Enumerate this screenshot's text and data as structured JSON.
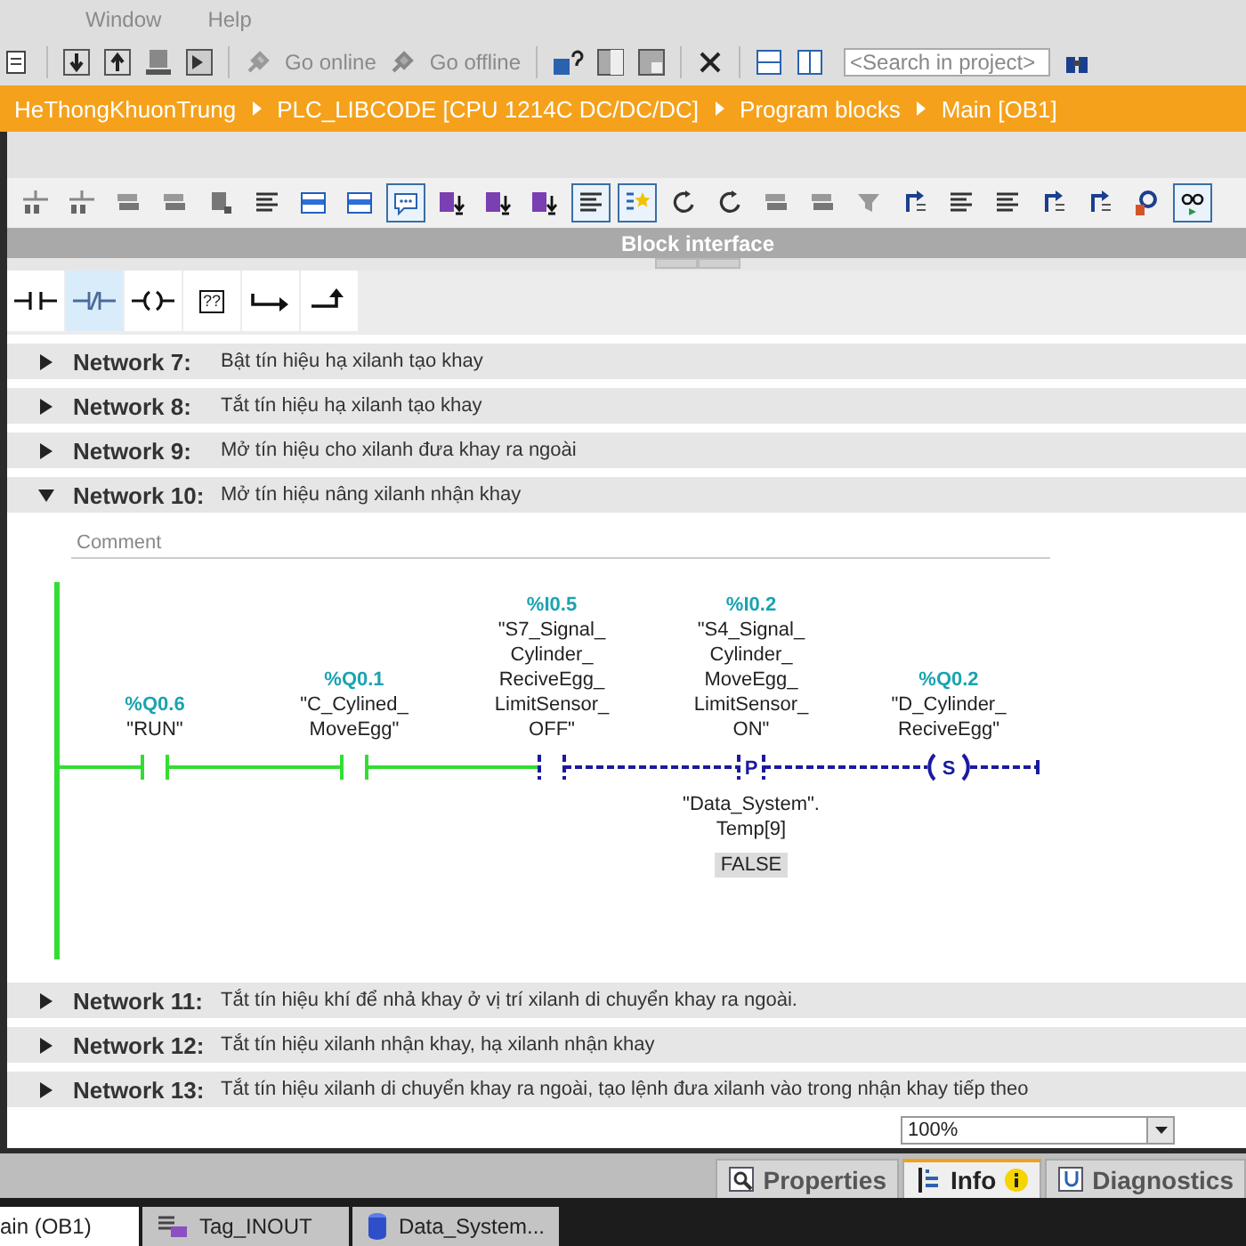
{
  "menu": [
    {
      "label": "Window"
    },
    {
      "label": "Help"
    }
  ],
  "toolbar": {
    "go_online": "Go online",
    "go_offline": "Go offline",
    "search": {
      "placeholder": "<Search in project>"
    }
  },
  "breadcrumb": [
    "HeThongKhuonTrung",
    "PLC_LIBCODE [CPU 1214C DC/DC/DC]",
    "Program blocks",
    "Main [OB1]"
  ],
  "editor_toolbar": [
    {
      "kind": "network",
      "selected": false
    },
    {
      "kind": "network",
      "selected": false
    },
    {
      "kind": "stack",
      "selected": false
    },
    {
      "kind": "stack",
      "selected": false
    },
    {
      "kind": "block",
      "selected": false
    },
    {
      "kind": "list",
      "selected": false
    },
    {
      "kind": "panel",
      "selected": false
    },
    {
      "kind": "panel",
      "selected": false
    },
    {
      "kind": "comment",
      "selected": true
    },
    {
      "kind": "download",
      "selected": false
    },
    {
      "kind": "download",
      "selected": false
    },
    {
      "kind": "download",
      "selected": false
    },
    {
      "kind": "list",
      "selected": true
    },
    {
      "kind": "star",
      "selected": true
    },
    {
      "kind": "refresh",
      "selected": false
    },
    {
      "kind": "refresh",
      "selected": false
    },
    {
      "kind": "stack",
      "selected": false
    },
    {
      "kind": "stack",
      "selected": false
    },
    {
      "kind": "funnel",
      "selected": false
    },
    {
      "kind": "jump",
      "selected": false
    },
    {
      "kind": "list",
      "selected": false
    },
    {
      "kind": "list",
      "selected": false
    },
    {
      "kind": "jump",
      "selected": false
    },
    {
      "kind": "jump",
      "selected": false
    },
    {
      "kind": "search",
      "selected": false
    },
    {
      "kind": "glasses",
      "selected": true
    }
  ],
  "block_interface": {
    "title": "Block interface"
  },
  "lad_elements": [
    {
      "kind": "no_contact",
      "selected": false
    },
    {
      "kind": "nc_contact",
      "selected": true
    },
    {
      "kind": "coil",
      "selected": false
    },
    {
      "kind": "box",
      "label": "??",
      "selected": false
    },
    {
      "kind": "branch_open",
      "selected": false
    },
    {
      "kind": "branch_close",
      "selected": false
    }
  ],
  "networks": [
    {
      "title": "Network 7:",
      "comment": "Bật tín hiệu hạ xilanh tạo khay",
      "expanded": false
    },
    {
      "title": "Network 8:",
      "comment": "Tắt tín hiệu hạ xilanh tạo khay",
      "expanded": false
    },
    {
      "title": "Network 9:",
      "comment": "Mở tín hiệu cho xilanh đưa khay ra ngoài",
      "expanded": false
    },
    {
      "title": "Network 10:",
      "comment": "Mở tín hiệu nâng xilanh nhận khay",
      "expanded": true,
      "comment_field": {
        "placeholder": "Comment"
      },
      "rung": [
        {
          "kind": "contact",
          "address": "%Q0.6",
          "tag": [
            "\"RUN\""
          ],
          "energized": true
        },
        {
          "kind": "contact",
          "address": "%Q0.1",
          "tag": [
            "\"C_Cylined_",
            "MoveEgg\""
          ],
          "energized": true
        },
        {
          "kind": "contact",
          "address": "%I0.5",
          "tag": [
            "\"S7_Signal_",
            "Cylinder_",
            "ReciveEgg_",
            "LimitSensor_",
            "OFF\""
          ],
          "energized": false
        },
        {
          "kind": "p_contact",
          "symbol": "P",
          "address": "%I0.2",
          "tag": [
            "\"S4_Signal_",
            "Cylinder_",
            "MoveEgg_",
            "LimitSensor_",
            "ON\""
          ],
          "operand": [
            "\"Data_System\".",
            "Temp[9]"
          ],
          "value": "FALSE",
          "energized": false
        },
        {
          "kind": "set_coil",
          "symbol": "S",
          "address": "%Q0.2",
          "tag": [
            "\"D_Cylinder_",
            "ReciveEgg\""
          ],
          "energized": false
        }
      ]
    },
    {
      "title": "Network 11:",
      "comment": "Tắt tín hiệu khí để nhả khay ở vị trí xilanh di chuyển khay ra ngoài.",
      "expanded": false
    },
    {
      "title": "Network 12:",
      "comment": "Tắt tín hiệu xilanh nhận khay, hạ xilanh nhận khay",
      "expanded": false
    },
    {
      "title": "Network 13:",
      "comment": "Tắt tín hiệu xilanh di chuyển khay ra ngoài, tạo lệnh đưa xilanh vào trong nhận khay tiếp theo",
      "expanded": false
    }
  ],
  "zoom": {
    "value": "100%"
  },
  "bottom_tabs": [
    {
      "label": "Properties",
      "kind": "properties",
      "selected": false
    },
    {
      "label": "Info",
      "kind": "info",
      "selected": true
    },
    {
      "label": "Diagnostics",
      "kind": "diagnostics",
      "selected": false
    }
  ],
  "taskbar": [
    {
      "label": "ain (OB1)",
      "kind": "block",
      "selected": true
    },
    {
      "label": "Tag_INOUT",
      "kind": "tags",
      "selected": false
    },
    {
      "label": "Data_System...",
      "kind": "db",
      "selected": false
    }
  ]
}
